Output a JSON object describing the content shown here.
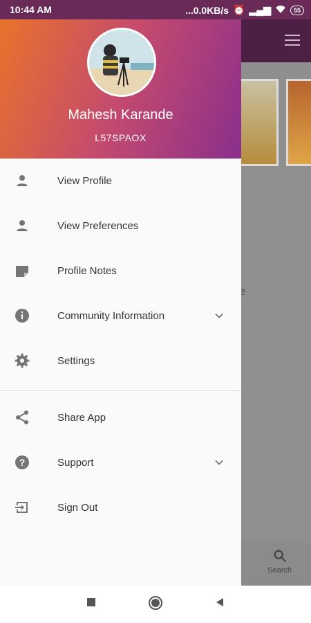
{
  "status_bar": {
    "time": "10:44 AM",
    "network_speed": "...0.0KB/s",
    "battery": "55"
  },
  "drawer": {
    "user_name": "Mahesh Karande",
    "user_code": "L57SPAOX",
    "menu_items": [
      {
        "label": "View Profile",
        "icon": "person-icon"
      },
      {
        "label": "View Preferences",
        "icon": "person-icon"
      },
      {
        "label": "Profile Notes",
        "icon": "note-icon"
      },
      {
        "label": "Community Information",
        "icon": "info-icon",
        "expandable": true
      },
      {
        "label": "Settings",
        "icon": "gear-icon"
      },
      {
        "label": "Share App",
        "icon": "share-icon"
      },
      {
        "label": "Support",
        "icon": "help-icon",
        "expandable": true
      },
      {
        "label": "Sign Out",
        "icon": "sign-out-icon"
      }
    ]
  },
  "background": {
    "partial_text": "e",
    "search_tab_label": "Search"
  },
  "colors": {
    "header_gradient_start": "#e8732b",
    "header_gradient_end": "#8a2f8c",
    "icon_gray": "#757575"
  }
}
